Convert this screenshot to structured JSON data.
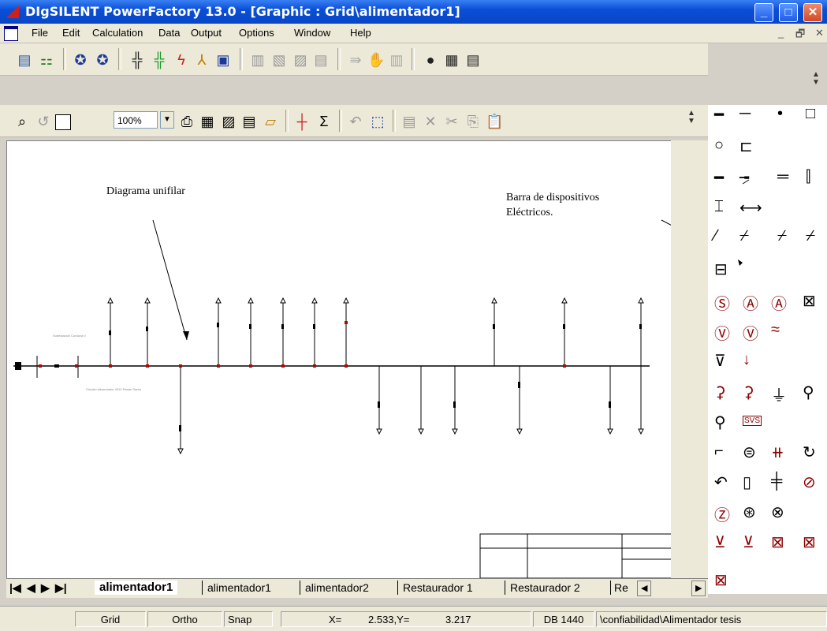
{
  "window": {
    "title": "DIgSILENT PowerFactory 13.0 - [Graphic : Grid\\alimentador1]"
  },
  "menu": [
    "File",
    "Edit",
    "Calculation",
    "Data",
    "Output",
    "Options",
    "Window",
    "Help"
  ],
  "toolbar": {
    "zoom": "100%"
  },
  "canvas": {
    "annotation_diagram": "Diagrama unifilar",
    "annotation_bar_line1": "Barra de dispositivos",
    "annotation_bar_line2": "Eléctricos."
  },
  "tabs": [
    "alimentador1",
    "alimentador1",
    "alimentador2",
    "Restaurador 1",
    "Restaurador 2",
    "Re"
  ],
  "status": {
    "grid": "Grid",
    "ortho": "Ortho",
    "snap": "Snap",
    "x_label": "X=",
    "x_value": "2.533,Y=",
    "y_value": "3.217",
    "db": "DB 1440",
    "path": "\\confiabilidad\\Alimentador tesis"
  },
  "palette_label": "SVS"
}
